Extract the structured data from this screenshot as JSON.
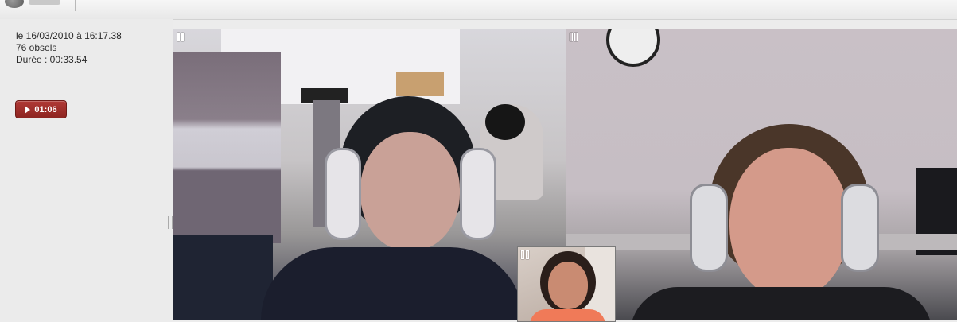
{
  "session": {
    "date_line": "le 16/03/2010 à 16:17.38",
    "obsels_line": "76 obsels",
    "duration_line": "Durée : 00:33.54"
  },
  "player": {
    "play_label": "01:06",
    "play_icon": "play-icon"
  },
  "videos": {
    "left_pause_icon": "pause-icon",
    "right_pause_icon": "pause-icon",
    "pip_pause_icon": "pause-icon"
  }
}
